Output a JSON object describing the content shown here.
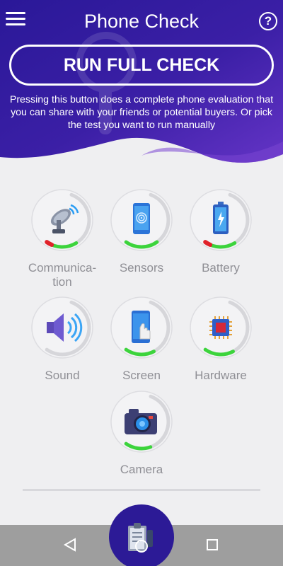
{
  "header": {
    "title": "Phone Check",
    "run_button": "RUN FULL CHECK",
    "description": "Pressing this button does a complete phone evaluation that you can share with your friends or potential buyers. Or pick the test you want to run manually"
  },
  "colors": {
    "hero_dark": "#2a1898",
    "hero_light": "#6434c6",
    "ring_green": "#3cd43c",
    "ring_red": "#e0222a",
    "ring_track": "#d6d6da",
    "label": "#8f8f95"
  },
  "tests": [
    {
      "label": "Communica-",
      "label2": "tion",
      "icon": "satellite-dish-icon",
      "green_fraction": 0.34,
      "red_tip": true
    },
    {
      "label": "Sensors",
      "icon": "fingerprint-phone-icon",
      "green_fraction": 0.36,
      "red_tip": false
    },
    {
      "label": "Battery",
      "icon": "battery-charging-icon",
      "green_fraction": 0.34,
      "red_tip": true
    },
    {
      "label": "Sound",
      "icon": "speaker-icon",
      "green_fraction": 0.0,
      "red_tip": false
    },
    {
      "label": "Screen",
      "icon": "phone-touch-icon",
      "green_fraction": 0.32,
      "red_tip": false
    },
    {
      "label": "Hardware",
      "icon": "cpu-chip-icon",
      "green_fraction": 0.32,
      "red_tip": false
    },
    {
      "label": "Camera",
      "icon": "camera-icon",
      "green_fraction": 0.28,
      "red_tip": false
    }
  ],
  "fab": {
    "icon": "report-clipboard-icon"
  },
  "navbar": {
    "back": "back-icon",
    "home": "home-icon",
    "recents": "recents-icon"
  }
}
